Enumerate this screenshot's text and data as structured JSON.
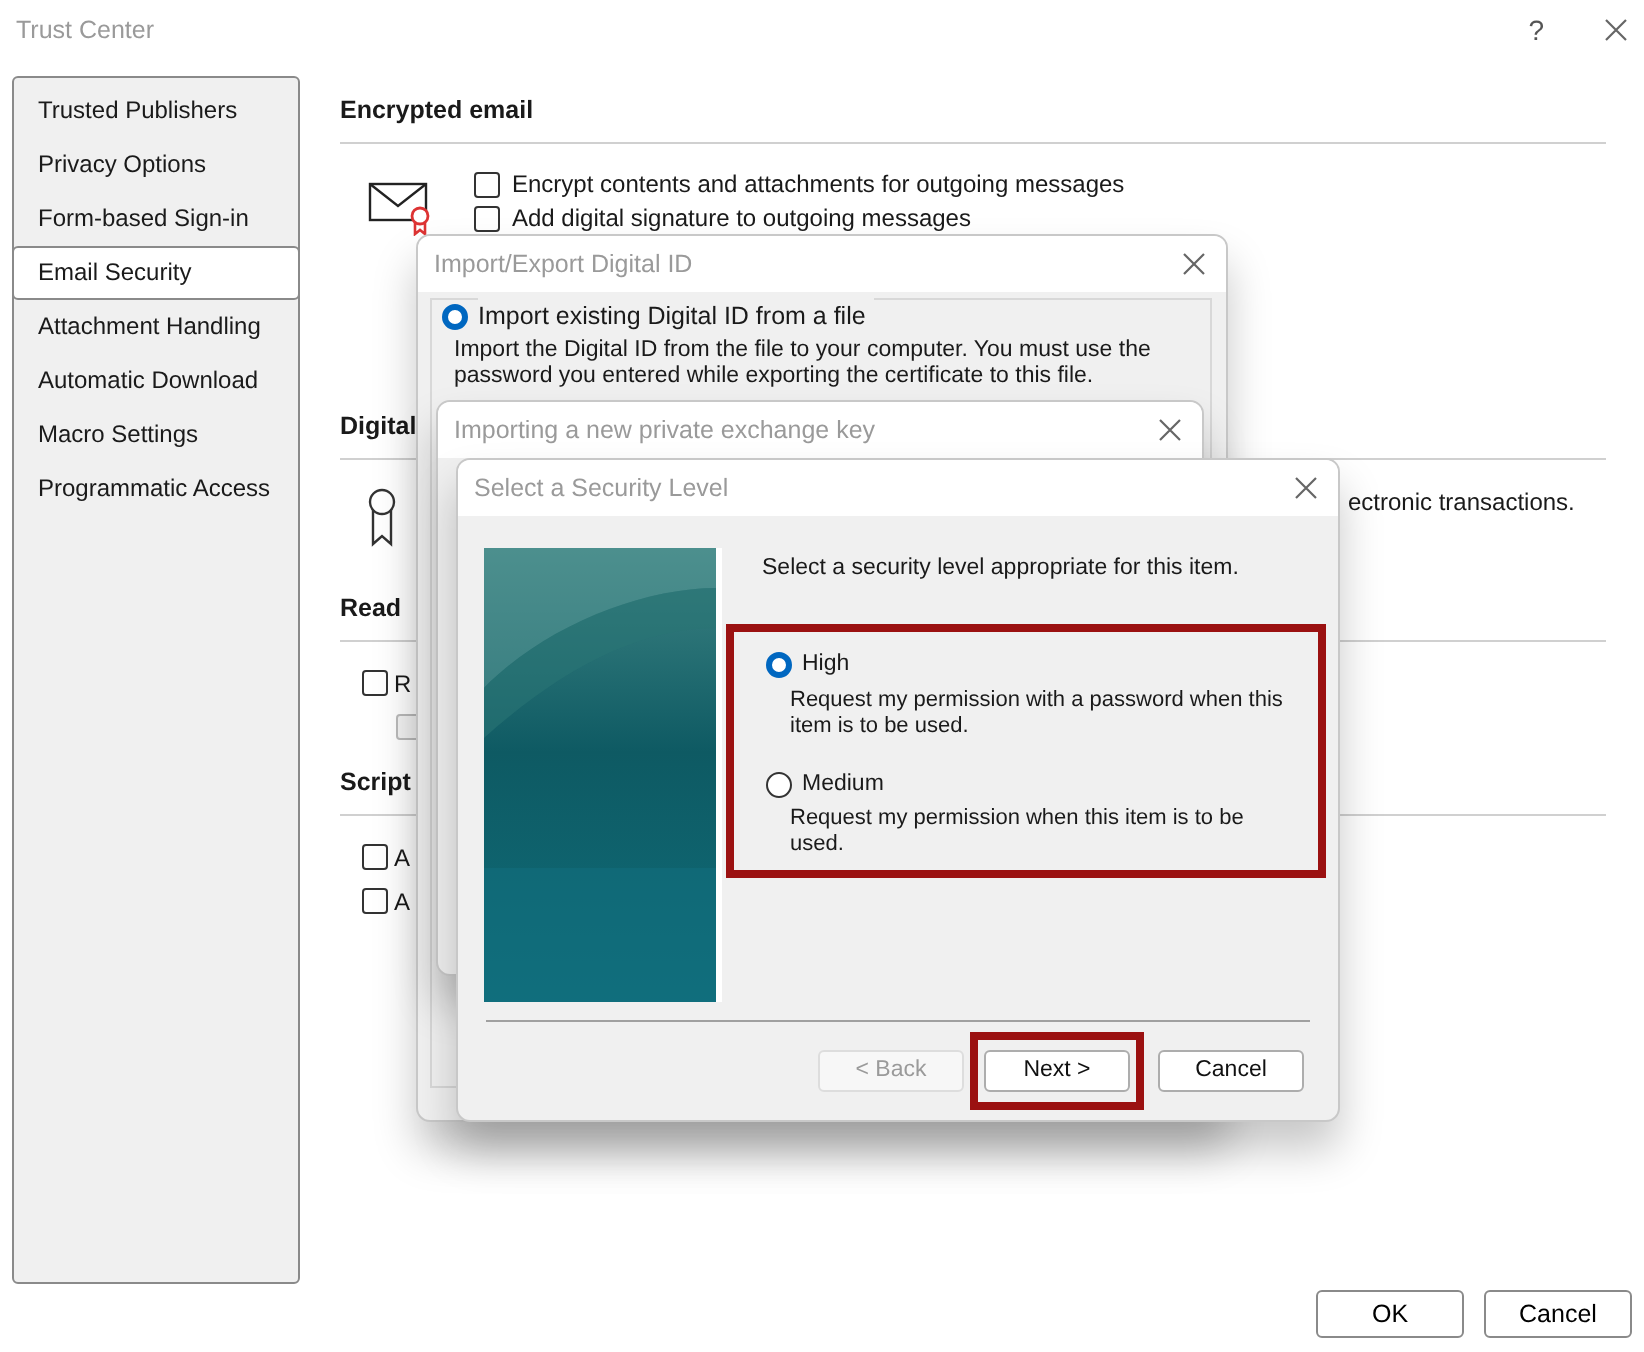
{
  "window": {
    "title": "Trust Center",
    "help": "?"
  },
  "sidebar": {
    "items": [
      {
        "label": "Trusted Publishers",
        "selected": false
      },
      {
        "label": "Privacy Options",
        "selected": false
      },
      {
        "label": "Form-based Sign-in",
        "selected": false
      },
      {
        "label": "Email Security",
        "selected": true
      },
      {
        "label": "Attachment Handling",
        "selected": false
      },
      {
        "label": "Automatic Download",
        "selected": false
      },
      {
        "label": "Macro Settings",
        "selected": false
      },
      {
        "label": "Programmatic Access",
        "selected": false
      }
    ]
  },
  "sections": [
    {
      "heading": "Encrypted email",
      "options": [
        {
          "kind": "checkbox",
          "label": "Encrypt contents and attachments for outgoing messages",
          "checked": false
        },
        {
          "kind": "checkbox",
          "label": "Add digital signature to outgoing messages",
          "checked": false
        }
      ]
    },
    {
      "heading": "Digital",
      "options": [
        {
          "kind": "text",
          "label": "ectronic transactions."
        }
      ]
    },
    {
      "heading": "Read",
      "options": [
        {
          "kind": "checkbox",
          "label": "R",
          "checked": false
        },
        {
          "kind": "subcheckbox",
          "checked": false,
          "disabled": true
        }
      ]
    },
    {
      "heading": "Script",
      "options": [
        {
          "kind": "checkbox",
          "label": "A",
          "checked": false
        },
        {
          "kind": "checkbox",
          "label": "A",
          "checked": false
        }
      ]
    }
  ],
  "buttons": [
    {
      "label": "OK"
    },
    {
      "label": "Cancel"
    }
  ],
  "import_export_dialog": {
    "title": "Import/Export Digital ID",
    "option": {
      "label": "Import existing Digital ID from a file",
      "selected": true
    },
    "description": "Import the Digital ID from the file to your computer. You must use the password you entered while exporting the certificate to this file."
  },
  "exchange_key_dialog": {
    "title": "Importing a new private exchange key"
  },
  "security_level_dialog": {
    "title": "Select a Security Level",
    "prompt": "Select a security level appropriate for this item.",
    "highlighted": true,
    "levels": [
      {
        "label": "High",
        "description": "Request my permission with a password when this item is to be used.",
        "selected": true
      },
      {
        "label": "Medium",
        "description": "Request my permission when this item is to be used.",
        "selected": false
      }
    ],
    "buttons": [
      {
        "label": "< Back",
        "disabled": true,
        "highlighted": false
      },
      {
        "label": "Next >",
        "disabled": false,
        "highlighted": true
      },
      {
        "label": "Cancel",
        "disabled": false,
        "highlighted": false
      }
    ]
  }
}
